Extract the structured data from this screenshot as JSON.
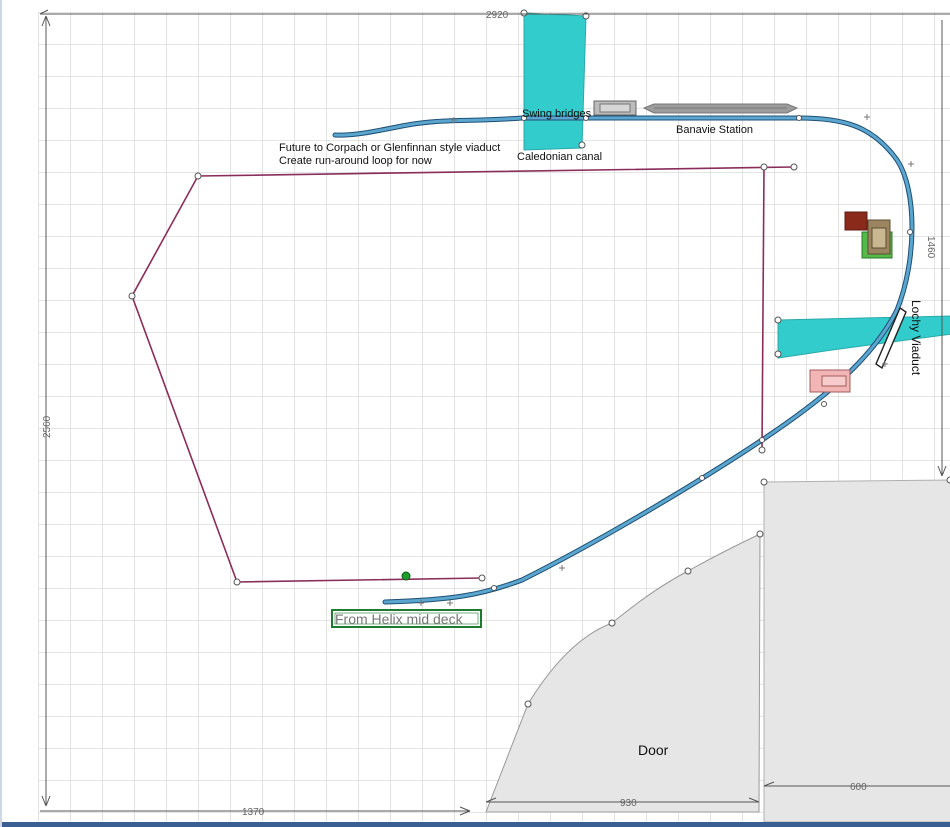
{
  "labels": {
    "swing_bridges": "Swing bridges",
    "banavie_station": "Banavie Station",
    "future_line1": "Future to Corpach or Glenfinnan style viaduct",
    "future_line2": "Create run-around loop for now",
    "caledonian_canal": "Caledonian canal",
    "lochy_viaduct": "Lochy Viaduct",
    "helix_box": "From Helix mid deck",
    "door": "Door"
  },
  "dimensions": {
    "top_width": "2920",
    "left_height": "2560",
    "right_height": "1460",
    "bottom_left": "1370",
    "bottom_middle": "930",
    "bottom_right": "600"
  },
  "colors": {
    "track": "#5aa6cf",
    "track_outline": "#1f4f73",
    "wire": "#8a2d5a",
    "water": "#33cccc",
    "door_fill": "#e6e6e6",
    "grid": "#c8c8c8",
    "helix_box": "#1d7a2f"
  }
}
